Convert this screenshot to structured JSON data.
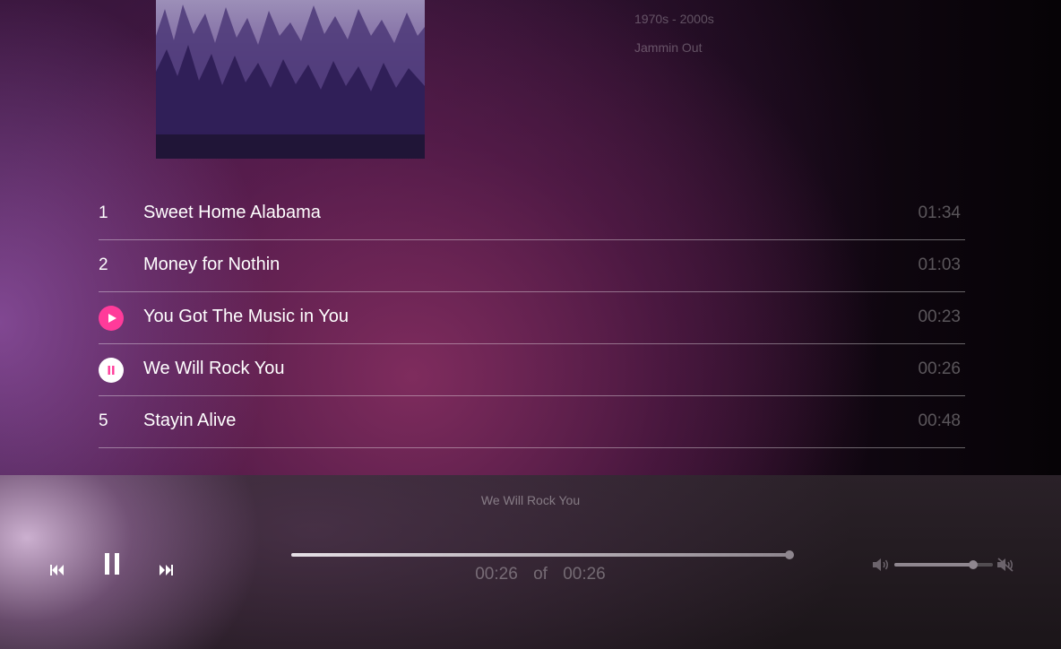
{
  "header": {
    "era": "1970s - 2000s",
    "playlist_name": "Jammin Out"
  },
  "tracks": [
    {
      "number": "1",
      "title": "Sweet Home Alabama",
      "duration": "01:34",
      "state": "idle"
    },
    {
      "number": "2",
      "title": "Money for Nothin",
      "duration": "01:03",
      "state": "idle"
    },
    {
      "number": "3",
      "title": "You Got The Music in You",
      "duration": "00:23",
      "state": "hover-play"
    },
    {
      "number": "4",
      "title": "We Will Rock You",
      "duration": "00:26",
      "state": "playing"
    },
    {
      "number": "5",
      "title": "Stayin Alive",
      "duration": "00:48",
      "state": "idle"
    }
  ],
  "player": {
    "now_playing": "We Will Rock You",
    "current_time": "00:26",
    "separator": "of",
    "total_time": "00:26",
    "progress_fraction": 1.0,
    "volume_fraction": 0.8
  },
  "icons": {
    "previous": "skip-back-icon",
    "pause": "pause-icon",
    "next": "skip-forward-icon",
    "volume": "volume-icon",
    "mute": "mute-icon",
    "track_play": "play-icon",
    "track_pause": "pause-icon"
  },
  "colors": {
    "accent_play": "#ff3b9a",
    "pause_button": "#ffffff"
  }
}
